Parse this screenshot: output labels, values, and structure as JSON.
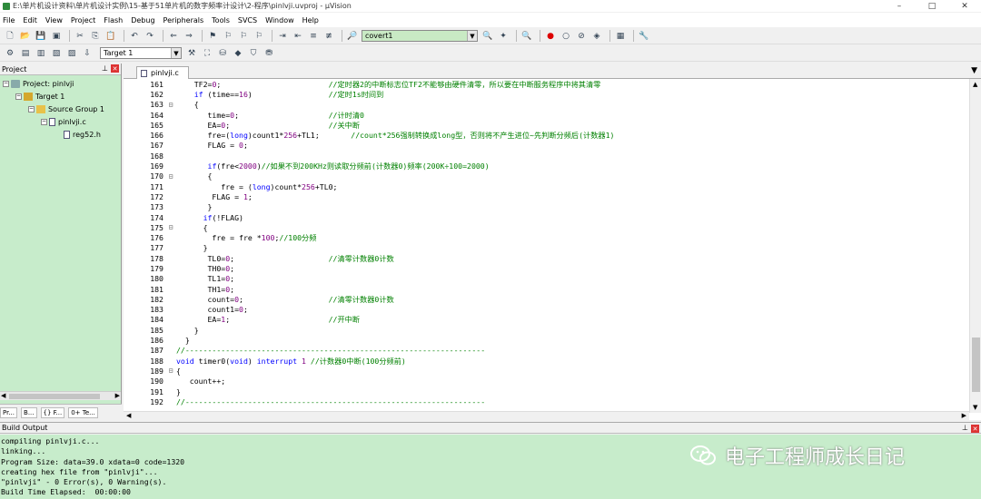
{
  "window": {
    "title": "E:\\单片机设计资料\\单片机设计实例\\15-基于51单片机的数字频率计设计\\2-程序\\pinlvji.uvproj - µVision",
    "controls": [
      "–",
      "□",
      "✕"
    ]
  },
  "menu": [
    "File",
    "Edit",
    "View",
    "Project",
    "Flash",
    "Debug",
    "Peripherals",
    "Tools",
    "SVCS",
    "Window",
    "Help"
  ],
  "toolbar": {
    "find_combo_value": "covert1",
    "target_combo_value": "Target 1"
  },
  "project_panel": {
    "title": "Project",
    "tree": [
      {
        "label": "Project: pinlvji",
        "level": 0
      },
      {
        "label": "Target 1",
        "level": 1
      },
      {
        "label": "Source Group 1",
        "level": 2
      },
      {
        "label": "pinlvji.c",
        "level": 3
      },
      {
        "label": "reg52.h",
        "level": 4
      }
    ],
    "tabs": [
      "Pr...",
      "B...",
      "{} F...",
      "0+ Te..."
    ]
  },
  "editor": {
    "tab": "pinlvji.c",
    "lines": [
      {
        "n": "161",
        "f": "",
        "t": "    TF2=0;                        //定时器2的中断标志位TF2不能够由硬件清零，所以要在中断服务程序中将其清零"
      },
      {
        "n": "162",
        "f": "",
        "t": "    if (time==16)                 //定时1s时间到"
      },
      {
        "n": "163",
        "f": "⊟",
        "t": "    {"
      },
      {
        "n": "164",
        "f": "",
        "t": "       time=0;                    //计时清0"
      },
      {
        "n": "165",
        "f": "",
        "t": "       EA=0;                      //关中断"
      },
      {
        "n": "166",
        "f": "",
        "t": "       fre=(long)count1*256+TL1;       //count*256强制转换成long型，否则将不产生进位~先判断分频后(计数器1)"
      },
      {
        "n": "167",
        "f": "",
        "t": "       FLAG = 0;"
      },
      {
        "n": "168",
        "f": "",
        "t": ""
      },
      {
        "n": "169",
        "f": "",
        "t": "       if(fre<2000)//如果不到200KHz则读取分频前(计数器0)频率(200K÷100=2000)"
      },
      {
        "n": "170",
        "f": "⊟",
        "t": "       {"
      },
      {
        "n": "171",
        "f": "",
        "t": "          fre = (long)count*256+TL0;"
      },
      {
        "n": "172",
        "f": "",
        "t": "        FLAG = 1;"
      },
      {
        "n": "173",
        "f": "",
        "t": "       }"
      },
      {
        "n": "174",
        "f": "",
        "t": "      if(!FLAG)"
      },
      {
        "n": "175",
        "f": "⊟",
        "t": "      {"
      },
      {
        "n": "176",
        "f": "",
        "t": "        fre = fre *100;//100分频"
      },
      {
        "n": "177",
        "f": "",
        "t": "      }"
      },
      {
        "n": "178",
        "f": "",
        "t": "       TL0=0;                     //清零计数器0计数"
      },
      {
        "n": "179",
        "f": "",
        "t": "       TH0=0;"
      },
      {
        "n": "180",
        "f": "",
        "t": "       TL1=0;"
      },
      {
        "n": "181",
        "f": "",
        "t": "       TH1=0;"
      },
      {
        "n": "182",
        "f": "",
        "t": "       count=0;                   //清零计数器0计数"
      },
      {
        "n": "183",
        "f": "",
        "t": "       count1=0;"
      },
      {
        "n": "184",
        "f": "",
        "t": "       EA=1;                      //开中断"
      },
      {
        "n": "185",
        "f": "",
        "t": "    }"
      },
      {
        "n": "186",
        "f": "",
        "t": "  }"
      },
      {
        "n": "187",
        "f": "",
        "t": "//-------------------------------------------------------------------"
      },
      {
        "n": "188",
        "f": "",
        "t": "void timer0(void) interrupt 1 //计数器0中断(100分频前)"
      },
      {
        "n": "189",
        "f": "⊟",
        "t": "{"
      },
      {
        "n": "190",
        "f": "",
        "t": "   count++;"
      },
      {
        "n": "191",
        "f": "",
        "t": "}"
      },
      {
        "n": "192",
        "f": "",
        "t": "//-------------------------------------------------------------------"
      }
    ]
  },
  "build_output": {
    "title": "Build Output",
    "lines": [
      "compiling pinlvji.c...",
      "linking...",
      "Program Size: data=39.0 xdata=0 code=1320",
      "creating hex file from \"pinlvji\"...",
      "\"pinlvji\" - 0 Error(s), 0 Warning(s).",
      "Build Time Elapsed:  00:00:00"
    ]
  },
  "watermark": "电子工程师成长日记",
  "colors": {
    "panel_bg": "#c7eccb",
    "comment": "#008000",
    "keyword": "#0000ff",
    "number": "#800080",
    "close_red": "#dd3333"
  }
}
